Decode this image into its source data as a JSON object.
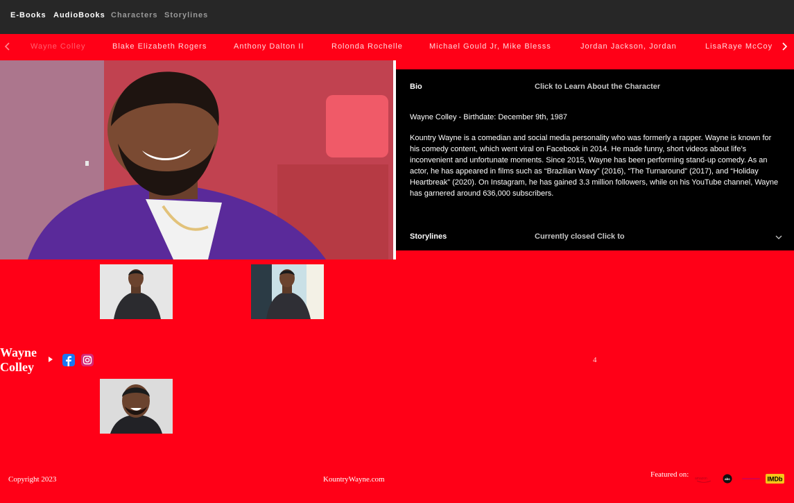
{
  "topnav": {
    "items": [
      {
        "label": "E-Books"
      },
      {
        "label": "AudioBooks"
      },
      {
        "label": "Characters"
      },
      {
        "label": "Storylines"
      }
    ]
  },
  "cast_bar": {
    "items": [
      {
        "label": "Wayne Colley"
      },
      {
        "label": "Blake Elizabeth Rogers"
      },
      {
        "label": "Anthony Dalton II"
      },
      {
        "label": "Rolonda Rochelle"
      },
      {
        "label": "Michael Gould Jr, Mike Blesss"
      },
      {
        "label": "Jordan Jackson, Jordan"
      },
      {
        "label": "LisaRaye McCoy"
      }
    ]
  },
  "info_panel": {
    "bio_label": "Bio",
    "bio_hint": "Click to Learn About the Character",
    "birth_line": "Wayne Colley - Birthdate: December 9th, 1987",
    "bio_text": "Kountry Wayne is a comedian and social media personality who was formerly a rapper. Wayne is known for his comedy content, which went viral on Facebook in 2014. He made funny, short videos about life’s inconvenient and unfortunate moments. Since 2015, Wayne has been performing stand-up comedy. As an actor, he has appeared in films such as “Brazilian Wavy” (2016), “The Turnaround” (2017), and “Holiday Heartbreak” (2020). On Instagram, he has gained 3.3 million followers, while on his YouTube channel, Wayne has garnered around 636,000 subscribers.",
    "storylines_label": "Storylines",
    "storylines_hint": "Currently closed Click to"
  },
  "character": {
    "name_line1": "Wayne",
    "name_line2": "Colley",
    "counter": "4"
  },
  "footer": {
    "copyright": "Copyright 2023",
    "site": "KountryWayne.com",
    "featured_label": "Featured on:",
    "featured_logos": [
      {
        "name": "amazon-logo",
        "text": "amazon"
      },
      {
        "name": "abc-logo",
        "text": "abc"
      },
      {
        "name": "partner-logo",
        "text": ""
      },
      {
        "name": "imdb-logo",
        "text": "IMDb"
      }
    ]
  },
  "colors": {
    "page_bg": "#ff0017",
    "topnav_bg": "#272727",
    "panel_bg": "#000000",
    "imdb_yellow": "#f5c518"
  }
}
